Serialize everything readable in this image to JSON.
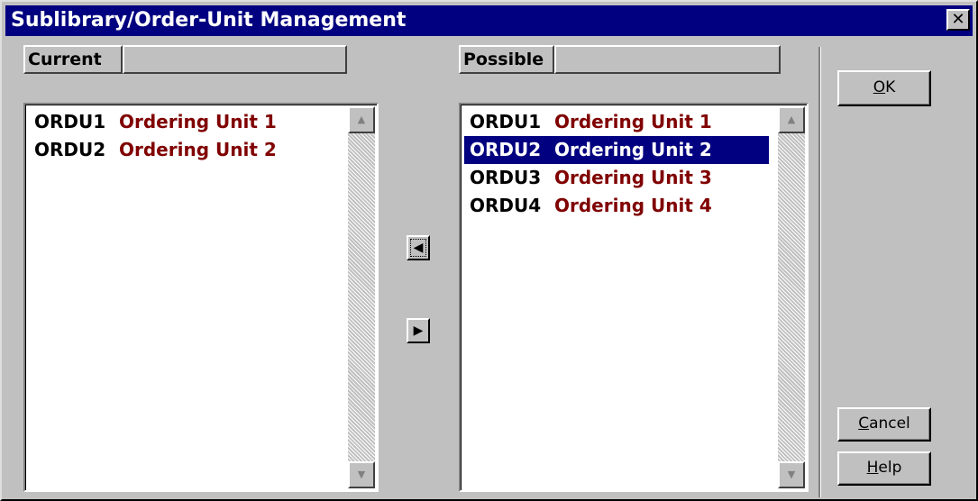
{
  "window": {
    "title": "Sublibrary/Order-Unit Management",
    "close_symbol": "✕"
  },
  "current": {
    "header": "Current",
    "items": [
      {
        "code": "ORDU1",
        "name": "Ordering Unit 1"
      },
      {
        "code": "ORDU2",
        "name": "Ordering Unit 2"
      }
    ]
  },
  "possible": {
    "header": "Possible",
    "selected_index": 1,
    "items": [
      {
        "code": "ORDU1",
        "name": "Ordering Unit 1"
      },
      {
        "code": "ORDU2",
        "name": "Ordering Unit 2"
      },
      {
        "code": "ORDU3",
        "name": "Ordering Unit 3"
      },
      {
        "code": "ORDU4",
        "name": "Ordering Unit 4"
      }
    ]
  },
  "transfer": {
    "add_icon": "arrow-left-icon",
    "remove_icon": "arrow-right-icon"
  },
  "buttons": {
    "ok": {
      "mnemonic": "O",
      "rest": "K"
    },
    "cancel": {
      "mnemonic": "C",
      "rest": "ancel"
    },
    "help": {
      "mnemonic": "H",
      "rest": "elp"
    }
  },
  "colors": {
    "titlebar": "#000080",
    "selection": "#000080",
    "name_text": "#800000"
  }
}
